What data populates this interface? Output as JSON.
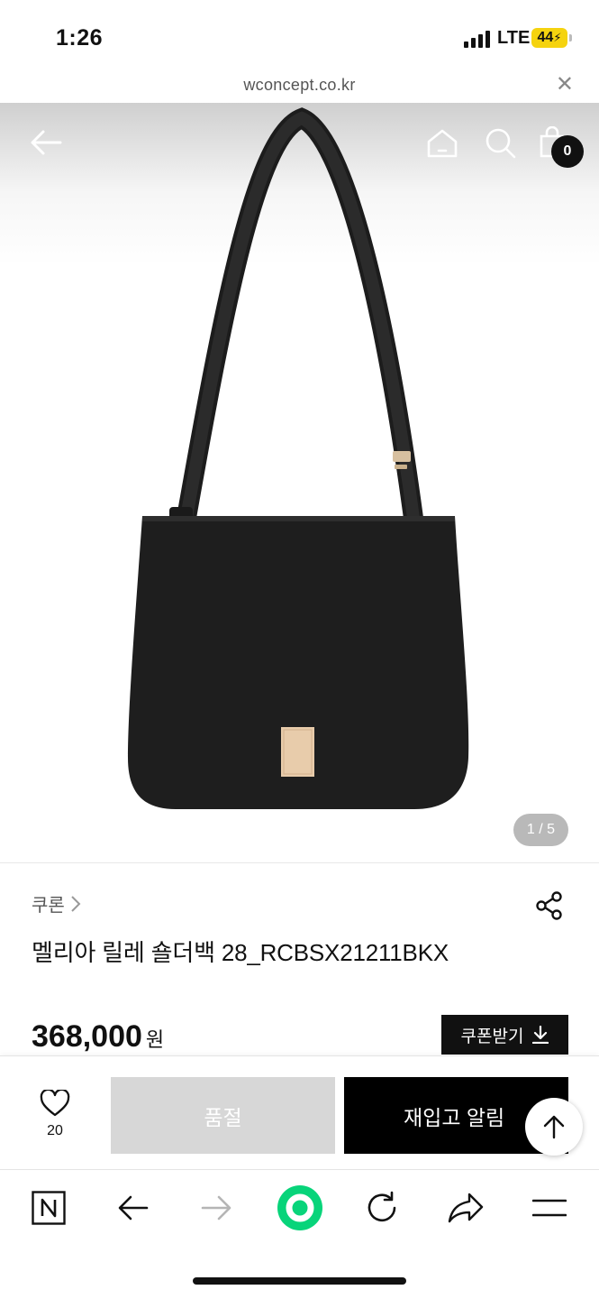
{
  "status": {
    "time": "1:26",
    "network": "LTE",
    "battery": "44"
  },
  "browser": {
    "url": "wconcept.co.kr",
    "close_icon": "close-icon"
  },
  "header": {
    "cart_count": "0"
  },
  "gallery": {
    "indicator": "1 / 5"
  },
  "product": {
    "brand": "쿠론",
    "name": "멜리아 릴레 숄더백 28_RCBSX21211BKX",
    "price": "368,000",
    "currency": "원",
    "coupon_label": "쿠폰받기"
  },
  "actions": {
    "like_count": "20",
    "soldout_label": "품절",
    "restock_label": "재입고 알림"
  },
  "colors": {
    "brand_green": "#08d47a",
    "soldout_gray": "#d7d7d7",
    "battery_yellow": "#f5d30f"
  }
}
